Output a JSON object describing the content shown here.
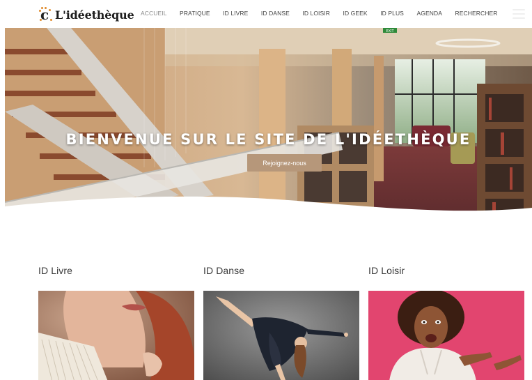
{
  "brand": {
    "name": "L'idéethèque",
    "mark": "c",
    "accent": "#e08a2a"
  },
  "nav": {
    "items": [
      {
        "label": "Accueil",
        "active": true
      },
      {
        "label": "Pratique"
      },
      {
        "label": "ID Livre"
      },
      {
        "label": "ID Danse"
      },
      {
        "label": "ID Loisir"
      },
      {
        "label": "ID Geek"
      },
      {
        "label": "ID Plus"
      },
      {
        "label": "Agenda"
      },
      {
        "label": "Rechercher"
      }
    ],
    "menu_icon": "hamburger-icon"
  },
  "hero": {
    "title": "BIENVENUE SUR LE SITE DE L'IDÉETHÈQUE",
    "button": "Rejoignez-nous",
    "button_color": "#b6977a",
    "exit_sign": "EXIT"
  },
  "sections": [
    {
      "title": "ID Livre",
      "image": "woman-reading-book-photo"
    },
    {
      "title": "ID Danse",
      "image": "dancer-leaping-photo"
    },
    {
      "title": "ID Loisir",
      "image": "woman-pointing-pink-background-photo"
    }
  ]
}
